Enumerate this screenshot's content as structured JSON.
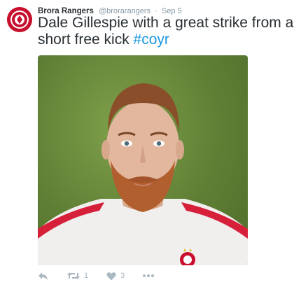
{
  "tweet": {
    "author_name": "Brora Rangers",
    "handle": "@brorarangers",
    "separator": "·",
    "date": "Sep 5",
    "text": "Dale Gillespie with a great strike from a short free kick ",
    "hashtag": "#coyr",
    "retweet_count": "1",
    "like_count": "3"
  },
  "icons": {
    "avatar": "club-crest-icon",
    "reply": "reply-icon",
    "retweet": "retweet-icon",
    "like": "heart-icon",
    "more": "more-icon"
  },
  "colors": {
    "link": "#1b95e0",
    "secondary": "#8899a6",
    "action": "#aab8c2",
    "crest": "#c8102e"
  }
}
